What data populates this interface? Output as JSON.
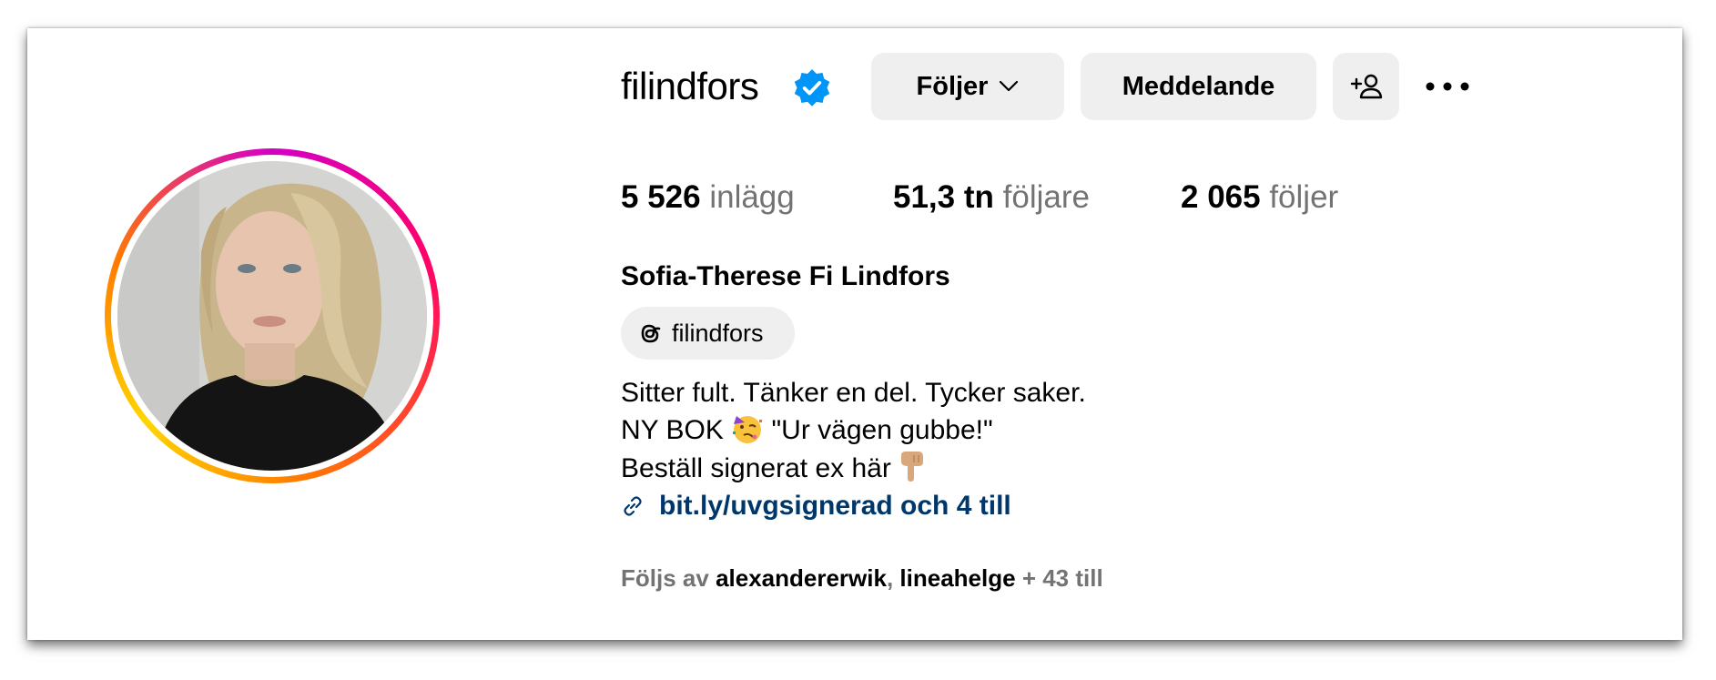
{
  "profile": {
    "username": "filindfors",
    "verified": true,
    "full_name": "Sofia-Therese Fi Lindfors",
    "threads_handle": "filindfors"
  },
  "actions": {
    "follow_label": "Följer",
    "message_label": "Meddelande"
  },
  "stats": {
    "posts_count": "5 526",
    "posts_label": "inlägg",
    "followers_count": "51,3 tn",
    "followers_label": "följare",
    "following_count": "2 065",
    "following_label": "följer"
  },
  "bio": {
    "line1": "Sitter fult. Tänker en del. Tycker saker.",
    "line2_a": "NY BOK",
    "line2_b": "\"Ur vägen gubbe!\"",
    "line3": "Beställ signerat ex här",
    "link": "bit.ly/uvgsignerad och 4 till"
  },
  "followed_by": {
    "prefix": "Följs av",
    "user1": "alexandererwik",
    "separator": ",",
    "user2": "lineahelge",
    "suffix": "+ 43 till"
  },
  "icons": {
    "verified": "verified-badge-icon",
    "chevron": "chevron-down-icon",
    "add_user": "add-user-icon",
    "more": "more-options-icon",
    "threads": "threads-icon",
    "link": "link-icon",
    "party_emoji": "partying-face-emoji",
    "point_emoji": "backhand-index-pointing-down-emoji"
  },
  "colors": {
    "verified_blue": "#0095f6",
    "link": "#00376b",
    "muted_text": "#737373",
    "button_bg": "#efefef"
  }
}
